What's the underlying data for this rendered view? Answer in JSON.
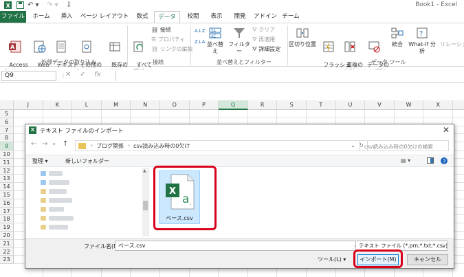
{
  "window": {
    "title": "Book1 - Excel"
  },
  "tabs": [
    "ファイル",
    "ホーム",
    "挿入",
    "ページ レイアウト",
    "数式",
    "データ",
    "校閲",
    "表示",
    "開発",
    "アドイン",
    "チーム"
  ],
  "ribbon": {
    "access": "Access\nデータベース",
    "web": "Web\nクエリ",
    "text": "テキスト\nファイル",
    "other": "その他の\nデータ ソース",
    "existing": "既存の\n接続",
    "refresh": "すべて\n更新",
    "connections": "接続",
    "properties": "プロパティ",
    "edit_links": "リンクの編集",
    "sort": "並べ替え",
    "filter": "フィルター",
    "clear": "クリア",
    "reapply": "再適用",
    "advanced": "詳細設定",
    "text_to_columns": "区切り位置",
    "flash_fill": "フラッシュ\nフィル",
    "remove_duplicates": "重複の\n削除",
    "validation": "データの\n入力規則",
    "consolidate": "統合",
    "whatif": "What-If 分析",
    "relationships": "リレーショ",
    "group_get_external": "外部データの取り込み",
    "group_connections": "接続",
    "group_sort_filter": "並べ替えとフィルター",
    "group_data_tools": "データ ツール"
  },
  "formula_bar": {
    "name_box": "Q9",
    "fx": "fx"
  },
  "columns": [
    "J",
    "K",
    "L",
    "M",
    "N",
    "O",
    "P",
    "Q",
    "R",
    "S",
    "T",
    "U",
    "V",
    "W",
    "X"
  ],
  "rows": [
    "5",
    "6",
    "7",
    "8",
    "9",
    "10",
    "11",
    "12",
    "13",
    "14",
    "15",
    "16",
    "17",
    "18",
    "19",
    "20",
    "21",
    "22",
    "23"
  ],
  "dialog": {
    "title": "テキスト ファイルのインポート",
    "breadcrumb_1": "ブログ関係",
    "breadcrumb_2": "csv読み込み時の0欠け",
    "search_placeholder": "csv読み込み時の0欠けの検索",
    "organize": "整理 ▾",
    "new_folder": "新しいフォルダー",
    "file_name": "ベース.csv",
    "file_name_label": "ファイル名(N):",
    "file_name_value": "ベース.csv",
    "file_type": "テキスト ファイル (*.prn;*.txt;*.csv)",
    "tools": "ツール(L)",
    "import_button": "インポート(M)",
    "cancel_button": "キャンセル"
  }
}
